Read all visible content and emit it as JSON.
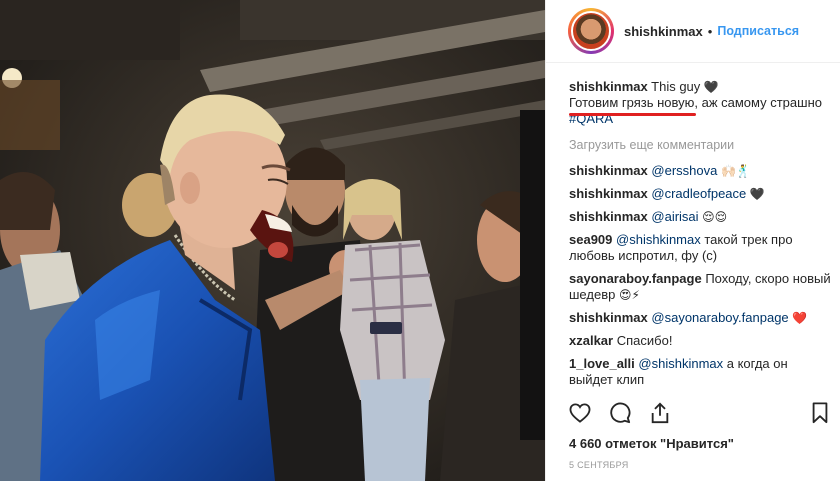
{
  "header": {
    "username": "shishkinmax",
    "separator": "•",
    "follow_label": "Подписаться"
  },
  "caption": {
    "username": "shishkinmax",
    "text_line1": "This guy",
    "emoji_line1": "🖤",
    "text_line2": "Готовим грязь новую",
    "text_line2_rest": ", аж самому страшно",
    "hashtag": "#QARA"
  },
  "load_more_label": "Загрузить еще комментарии",
  "comments": [
    {
      "user": "shishkinmax",
      "mention": "@ersshova",
      "text": "",
      "emoji": "🙌🏻🕺"
    },
    {
      "user": "shishkinmax",
      "mention": "@cradleofpeace",
      "text": "",
      "emoji": "🖤"
    },
    {
      "user": "shishkinmax",
      "mention": "@airisai",
      "text": "",
      "emoji": "😌😌"
    },
    {
      "user": "sea909",
      "mention": "@shishkinmax",
      "text": " такой трек про любовь испротил, фу (с)",
      "emoji": ""
    },
    {
      "user": "sayonaraboy.fanpage",
      "mention": "",
      "text": "Походу, скоро новый шедевр",
      "emoji": "😍⚡"
    },
    {
      "user": "shishkinmax",
      "mention": "@sayonaraboy.fanpage",
      "text": "",
      "emoji": "❤️"
    },
    {
      "user": "xzalkar",
      "mention": "",
      "text": "Спасибо!",
      "emoji": ""
    },
    {
      "user": "1_love_alli",
      "mention": "@shishkinmax",
      "text": " а когда он выйдет клип",
      "emoji": ""
    }
  ],
  "likes_label": "4 660 отметок \"Нравится\"",
  "date_label": "5 сентября",
  "icons": [
    "heart-icon",
    "comment-icon",
    "share-icon",
    "bookmark-icon"
  ],
  "colors": {
    "accent": "#3897f0",
    "link": "#003569",
    "underline": "#e02020",
    "muted": "#999999"
  }
}
